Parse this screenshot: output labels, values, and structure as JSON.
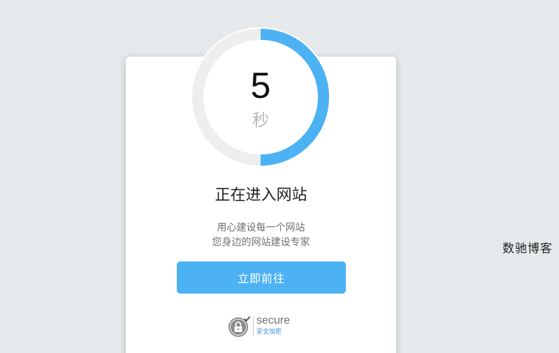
{
  "countdown": {
    "value": "5",
    "unit": "秒",
    "progress_fraction": 0.5
  },
  "heading": "正在进入网站",
  "description": {
    "line1": "用心建设每一个网站",
    "line2": "您身边的网站建设专家"
  },
  "actions": {
    "go_label": "立即前往"
  },
  "secure": {
    "icon": "lock-icon",
    "label": "secure",
    "sublabel": "安全加密"
  },
  "watermark": "数驰博客",
  "colors": {
    "accent": "#4cb2f3",
    "ring_track": "#eeeeee",
    "background": "#e6e9eb",
    "card": "#ffffff"
  }
}
